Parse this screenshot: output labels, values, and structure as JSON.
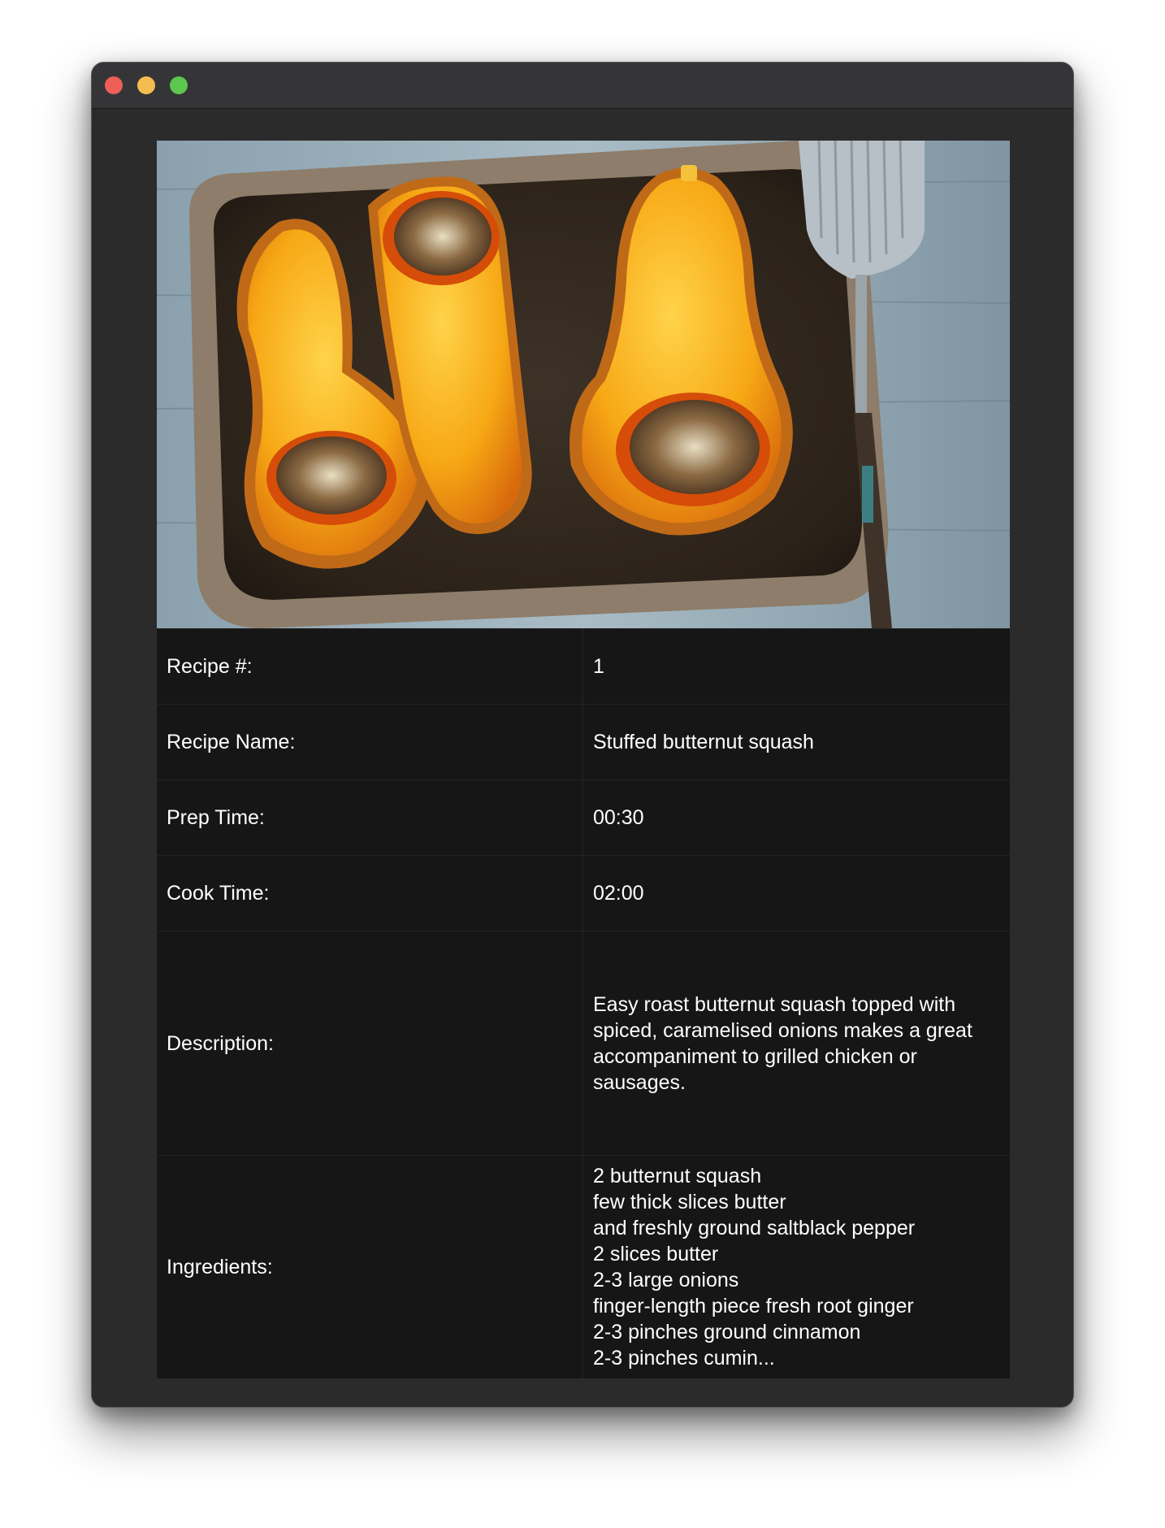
{
  "window": {
    "controls": {
      "close_color": "#ee5f57",
      "minimize_color": "#f5bd4f",
      "zoom_color": "#5ec74f"
    }
  },
  "recipe": {
    "image_alt": "Stuffed butternut squash",
    "rows": {
      "id": {
        "label": "Recipe #:",
        "value": "1"
      },
      "name": {
        "label": "Recipe Name:",
        "value": "Stuffed butternut squash"
      },
      "prep": {
        "label": "Prep Time:",
        "value": "00:30"
      },
      "cook": {
        "label": "Cook Time:",
        "value": "02:00"
      },
      "description": {
        "label": "Description:",
        "value": "Easy roast butternut squash topped with spiced, caramelised onions makes a great accompaniment to grilled chicken or sausages."
      },
      "ingredients": {
        "label": "Ingredients:",
        "value": "2 butternut squash\nfew thick slices butter\nand freshly ground saltblack pepper\n2 slices butter\n2-3 large onions\nfinger-length piece fresh root ginger\n2-3 pinches ground cinnamon\n2-3 pinches cumin..."
      }
    }
  }
}
